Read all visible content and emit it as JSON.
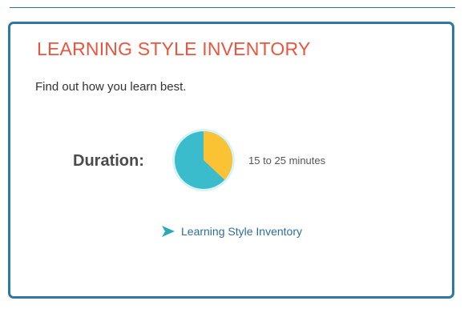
{
  "card": {
    "title": "LEARNING STYLE INVENTORY",
    "description": "Find out how you learn best."
  },
  "duration": {
    "label": "Duration:",
    "value": "15 to 25 minutes",
    "pie": {
      "icon": "pie-chart-icon",
      "highlight_fraction": 0.37,
      "colors": {
        "base": "#3bbccc",
        "highlight": "#fbc234",
        "ring": "#d8f3f6"
      }
    }
  },
  "link": {
    "icon": "arrow-right-icon",
    "label": "Learning Style Inventory",
    "color": "#2f6d96",
    "icon_color": "#2aa9b8"
  },
  "colors": {
    "border": "#2f78a6",
    "title": "#e8563f"
  }
}
